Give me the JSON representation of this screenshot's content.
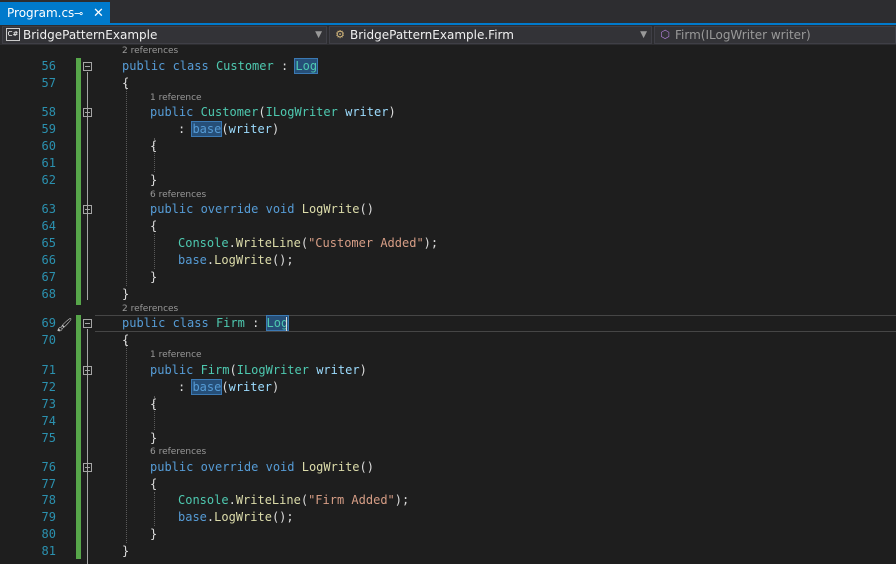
{
  "tab": {
    "name": "Program.cs",
    "pin_glyph": "⊸",
    "close_glyph": "✕"
  },
  "nav": {
    "project": "BridgePatternExample",
    "project_icon": "C#",
    "class": "BridgePatternExample.Firm",
    "member": "Firm(ILogWriter writer)"
  },
  "editor": {
    "lens": [
      "2 references",
      "1 reference",
      "6 references",
      "2 references",
      "1 reference",
      "6 references"
    ],
    "lines": [
      {
        "num": "56",
        "code": [
          [
            "kw",
            "public "
          ],
          [
            "kw",
            "class "
          ],
          [
            "ty",
            "Customer"
          ],
          [
            "p",
            " : "
          ],
          [
            "tyhl",
            "Log"
          ]
        ]
      },
      {
        "num": "57",
        "code": [
          [
            "p",
            "{"
          ]
        ]
      },
      {
        "num": "58",
        "code": [
          [
            "kw",
            "public "
          ],
          [
            "ty",
            "Customer"
          ],
          [
            "p",
            "("
          ],
          [
            "ty",
            "ILogWriter "
          ],
          [
            "pr",
            "writer"
          ],
          [
            "p",
            ")"
          ]
        ]
      },
      {
        "num": "59",
        "code": [
          [
            "p",
            ": "
          ],
          [
            "kwhl",
            "base"
          ],
          [
            "p",
            "("
          ],
          [
            "pr",
            "writer"
          ],
          [
            "p",
            ")"
          ]
        ]
      },
      {
        "num": "60",
        "code": [
          [
            "p",
            "{"
          ]
        ]
      },
      {
        "num": "61",
        "code": []
      },
      {
        "num": "62",
        "code": [
          [
            "p",
            "}"
          ]
        ]
      },
      {
        "num": "63",
        "code": [
          [
            "kw",
            "public "
          ],
          [
            "kw",
            "override "
          ],
          [
            "kw",
            "void "
          ],
          [
            "mt",
            "LogWrite"
          ],
          [
            "p",
            "()"
          ]
        ]
      },
      {
        "num": "64",
        "code": [
          [
            "p",
            "{"
          ]
        ]
      },
      {
        "num": "65",
        "code": [
          [
            "ty",
            "Console"
          ],
          [
            "p",
            "."
          ],
          [
            "mt",
            "WriteLine"
          ],
          [
            "p",
            "("
          ],
          [
            "st",
            "\"Customer Added\""
          ],
          [
            "p",
            ");"
          ]
        ]
      },
      {
        "num": "66",
        "code": [
          [
            "kw",
            "base"
          ],
          [
            "p",
            "."
          ],
          [
            "mt",
            "LogWrite"
          ],
          [
            "p",
            "();"
          ]
        ]
      },
      {
        "num": "67",
        "code": [
          [
            "p",
            "}"
          ]
        ]
      },
      {
        "num": "68",
        "code": [
          [
            "p",
            "}"
          ]
        ]
      },
      {
        "num": "69",
        "code": [
          [
            "kw",
            "public "
          ],
          [
            "kw",
            "class "
          ],
          [
            "ty",
            "Firm"
          ],
          [
            "p",
            " : "
          ],
          [
            "tyhl",
            "Log"
          ]
        ]
      },
      {
        "num": "70",
        "code": [
          [
            "p",
            "{"
          ]
        ]
      },
      {
        "num": "71",
        "code": [
          [
            "kw",
            "public "
          ],
          [
            "ty",
            "Firm"
          ],
          [
            "p",
            "("
          ],
          [
            "ty",
            "ILogWriter "
          ],
          [
            "pr",
            "writer"
          ],
          [
            "p",
            ")"
          ]
        ]
      },
      {
        "num": "72",
        "code": [
          [
            "p",
            ": "
          ],
          [
            "kwhl",
            "base"
          ],
          [
            "p",
            "("
          ],
          [
            "pr",
            "writer"
          ],
          [
            "p",
            ")"
          ]
        ]
      },
      {
        "num": "73",
        "code": [
          [
            "p",
            "{"
          ]
        ]
      },
      {
        "num": "74",
        "code": []
      },
      {
        "num": "75",
        "code": [
          [
            "p",
            "}"
          ]
        ]
      },
      {
        "num": "76",
        "code": [
          [
            "kw",
            "public "
          ],
          [
            "kw",
            "override "
          ],
          [
            "kw",
            "void "
          ],
          [
            "mt",
            "LogWrite"
          ],
          [
            "p",
            "()"
          ]
        ]
      },
      {
        "num": "77",
        "code": [
          [
            "p",
            "{"
          ]
        ]
      },
      {
        "num": "78",
        "code": [
          [
            "ty",
            "Console"
          ],
          [
            "p",
            "."
          ],
          [
            "mt",
            "WriteLine"
          ],
          [
            "p",
            "("
          ],
          [
            "st",
            "\"Firm Added\""
          ],
          [
            "p",
            ");"
          ]
        ]
      },
      {
        "num": "79",
        "code": [
          [
            "kw",
            "base"
          ],
          [
            "p",
            "."
          ],
          [
            "mt",
            "LogWrite"
          ],
          [
            "p",
            "();"
          ]
        ]
      },
      {
        "num": "80",
        "code": [
          [
            "p",
            "}"
          ]
        ]
      },
      {
        "num": "81",
        "code": [
          [
            "p",
            "}"
          ]
        ]
      }
    ]
  }
}
